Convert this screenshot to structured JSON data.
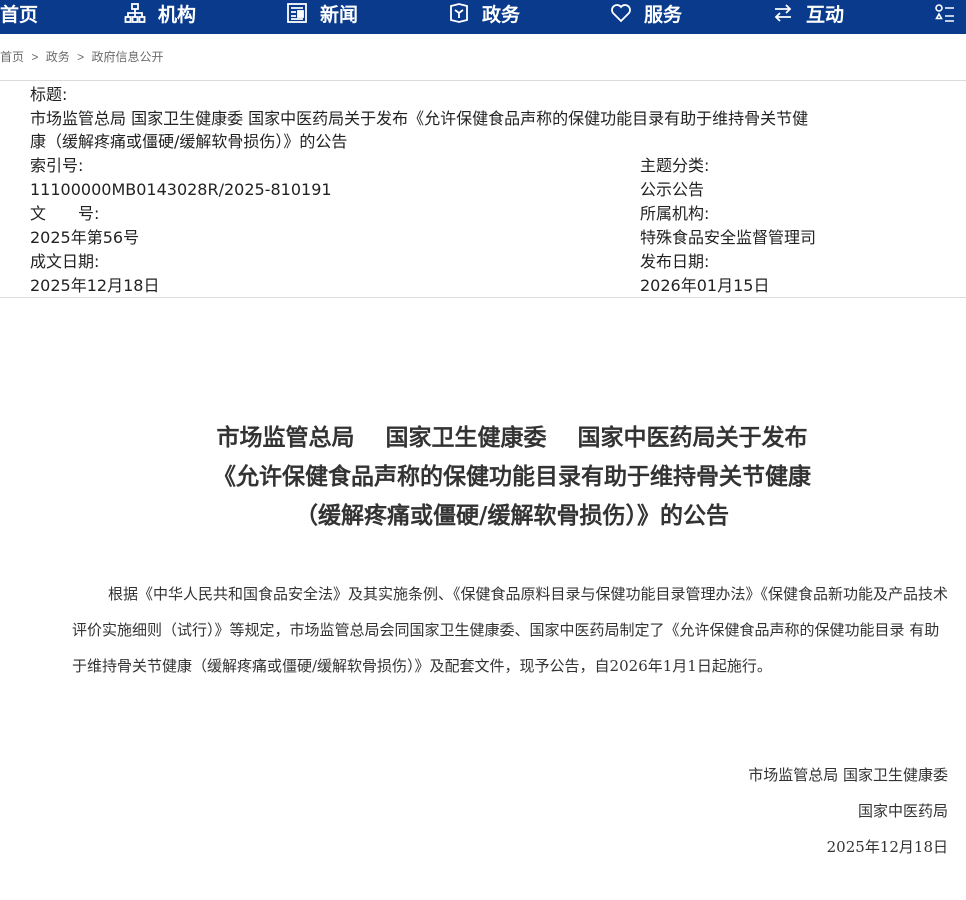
{
  "nav": {
    "items": [
      {
        "label": "首页",
        "icon": "home"
      },
      {
        "label": "机构",
        "icon": "org-chart-icon"
      },
      {
        "label": "新闻",
        "icon": "newspaper-icon"
      },
      {
        "label": "政务",
        "icon": "government-icon"
      },
      {
        "label": "服务",
        "icon": "heart-icon"
      },
      {
        "label": "互动",
        "icon": "exchange-arrows-icon"
      }
    ]
  },
  "breadcrumb": {
    "items": [
      "首页",
      "政务",
      "政府信息公开"
    ],
    "separator": ">"
  },
  "meta": {
    "title_label": "标题:",
    "title_value": "市场监管总局 国家卫生健康委 国家中医药局关于发布《允许保健食品声称的保健功能目录有助于维持骨关节健康（缓解疼痛或僵硬/缓解软骨损伤）》的公告",
    "title_line1": "市场监管总局 国家卫生健康委 国家中医药局关于发布《允许保健食品声称的保健功能目录有助于维持骨关节健",
    "title_line2": "康（缓解疼痛或僵硬/缓解软骨损伤）》的公告",
    "index_label": "索引号:",
    "index_value": "11100000MB0143028R/2025-810191",
    "topic_label": "主题分类:",
    "topic_value": "公示公告",
    "docno_label": "文　　号:",
    "docno_value": "2025年第56号",
    "org_label": "所属机构:",
    "org_value": "特殊食品安全监督管理司",
    "created_label": "成文日期:",
    "created_value": "2025年12月18日",
    "published_label": "发布日期:",
    "published_value": "2026年01月15日"
  },
  "article": {
    "heading_line1": "市场监管总局　 国家卫生健康委　 国家中医药局关于发布",
    "heading_line2": "《允许保健食品声称的保健功能目录有助于维持骨关节健康",
    "heading_line3": "（缓解疼痛或僵硬/缓解软骨损伤）》的公告",
    "paragraph": "根据《中华人民共和国食品安全法》及其实施条例、《保健食品原料目录与保健功能目录管理办法》《保健食品新功能及产品技术评价实施细则（试行）》等规定，市场监管总局会同国家卫生健康委、国家中医药局制定了《允许保健食品声称的保健功能目录 有助于维持骨关节健康（缓解疼痛或僵硬/缓解软骨损伤）》及配套文件，现予公告，自2026年1月1日起施行。",
    "signature_line1": "市场监管总局 国家卫生健康委",
    "signature_line2": "国家中医药局",
    "signature_date": "2025年12月18日"
  }
}
